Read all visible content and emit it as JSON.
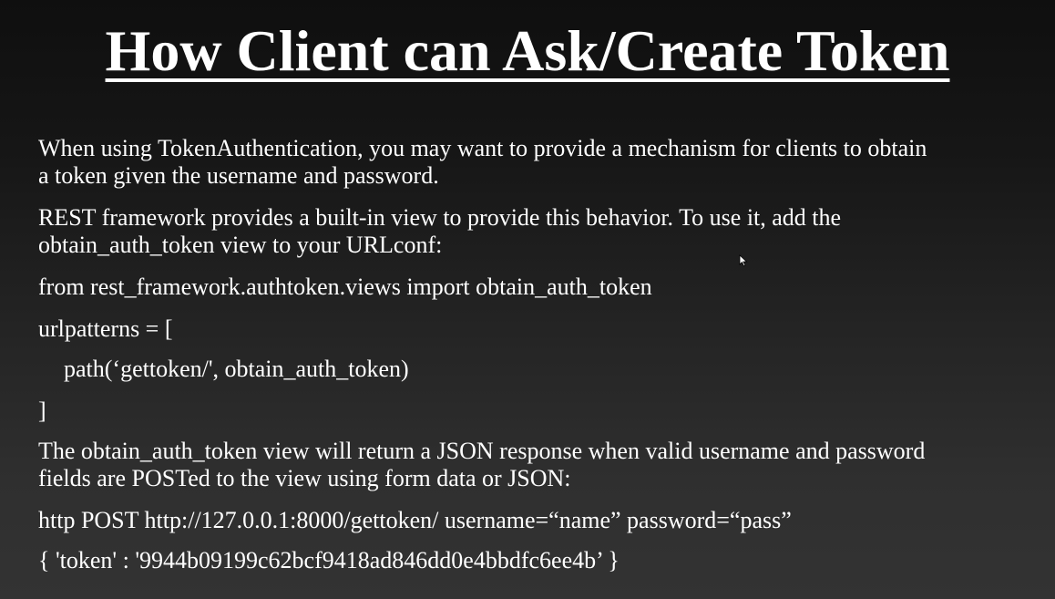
{
  "slide": {
    "title": "How Client can Ask/Create Token",
    "paragraphs": {
      "intro_line1": "When using TokenAuthentication, you may want to provide a mechanism for clients to obtain",
      "intro_line2": "a token given the username and password.",
      "builtin_line1": "REST framework provides a built-in view to provide this behavior. To use it, add the",
      "builtin_line2": "obtain_auth_token view to your URLconf:",
      "import_line": "from rest_framework.authtoken.views import obtain_auth_token",
      "urlpatterns_open": "urlpatterns = [",
      "path_line": "path(‘gettoken/', obtain_auth_token)",
      "urlpatterns_close": "]",
      "response_line1": "The obtain_auth_token view will return a JSON response when valid username and password",
      "response_line2": "fields are POSTed to the view using form data or JSON:",
      "http_line": "http POST http://127.0.0.1:8000/gettoken/ username=“name” password=“pass”",
      "token_line": "{ 'token' : '9944b09199c62bcf9418ad846dd0e4bbdfc6ee4b’ }"
    }
  },
  "icons": {
    "cursor": "mouse-pointer-icon"
  },
  "colors": {
    "background_top": "#0f0f0f",
    "background_bottom": "#333333",
    "text": "#ffffff"
  }
}
